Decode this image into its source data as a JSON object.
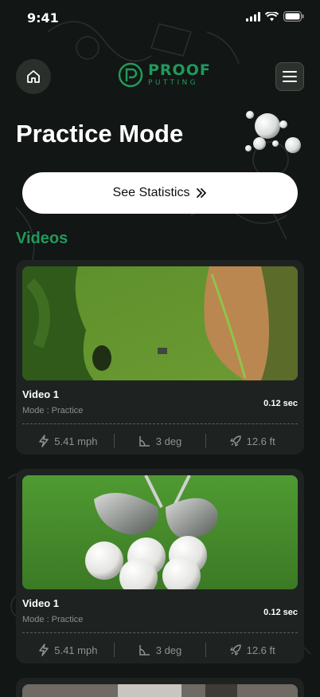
{
  "status": {
    "time": "9:41"
  },
  "brand": {
    "name": "PROOF",
    "tagline": "PUTTING"
  },
  "page": {
    "title": "Practice Mode"
  },
  "stats_button": {
    "label": "See Statistics",
    "icon": "double-chevron-right-icon"
  },
  "videos": {
    "title": "Videos",
    "items": [
      {
        "title": "Video 1",
        "mode": "Mode : Practice",
        "duration": "0.12 sec",
        "speed": "5.41 mph",
        "angle": "3 deg",
        "distance": "12.6 ft",
        "thumbnail": "aerial golf green"
      },
      {
        "title": "Video 1",
        "mode": "Mode : Practice",
        "duration": "0.12 sec",
        "speed": "5.41 mph",
        "angle": "3 deg",
        "distance": "12.6 ft",
        "thumbnail": "golf balls with clubs"
      }
    ]
  },
  "colors": {
    "background": "#121614",
    "accent": "#1f9a5c",
    "card": "#1e2321",
    "muted": "#8a908c"
  }
}
